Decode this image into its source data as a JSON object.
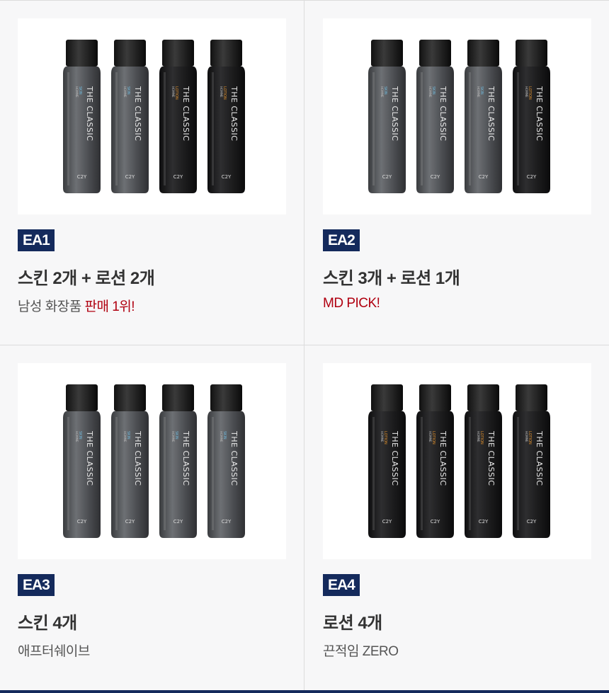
{
  "cards": [
    {
      "tag": "EA1",
      "title": "스킨 2개 + 로션 2개",
      "sub_plain": "남성 화장품 ",
      "sub_highlight": "판매 1위!",
      "bottles": [
        "skin",
        "skin",
        "lotion",
        "lotion"
      ]
    },
    {
      "tag": "EA2",
      "title": "스킨 3개 + 로션 1개",
      "sub_plain": "",
      "sub_highlight": "MD PICK!",
      "bottles": [
        "skin",
        "skin",
        "skin",
        "lotion"
      ]
    },
    {
      "tag": "EA3",
      "title": "스킨 4개",
      "sub_plain": "애프터쉐이브",
      "sub_highlight": "",
      "bottles": [
        "skin",
        "skin",
        "skin",
        "skin"
      ]
    },
    {
      "tag": "EA4",
      "title": "로션 4개",
      "sub_plain": "끈적임 ZERO",
      "sub_highlight": "",
      "bottles": [
        "lotion",
        "lotion",
        "lotion",
        "lotion"
      ]
    }
  ],
  "bottle_labels": {
    "brand": "THE CLASSIC",
    "logo": "C2Y",
    "skin": "SKIN",
    "lotion": "LOTION",
    "line": "HOMME"
  },
  "colors": {
    "tag_bg": "#142a5c",
    "highlight": "#b00010",
    "skin_body": "#5a5c5f",
    "lotion_body": "#1c1c1d"
  }
}
